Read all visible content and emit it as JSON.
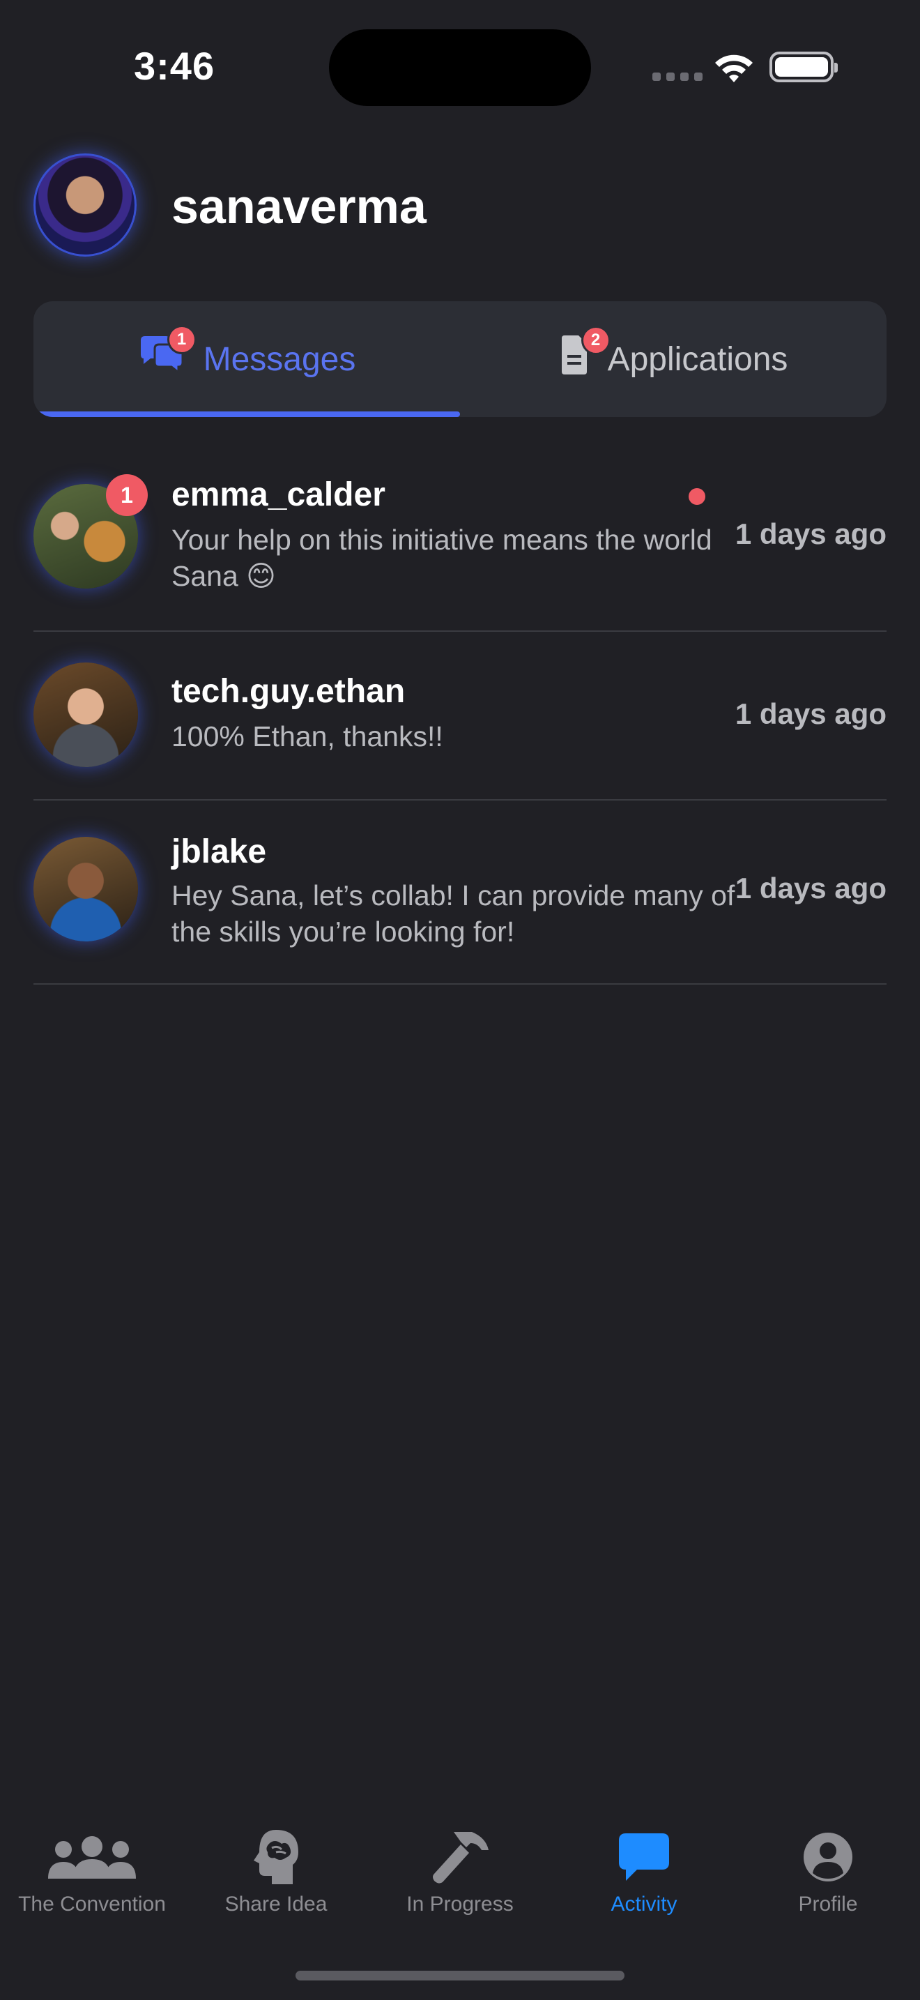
{
  "status_bar": {
    "time": "3:46"
  },
  "header": {
    "username": "sanaverma"
  },
  "tabs": [
    {
      "label": "Messages",
      "badge": "1",
      "icon": "chat-bubbles-icon",
      "active": true
    },
    {
      "label": "Applications",
      "badge": "2",
      "icon": "document-icon",
      "active": false
    }
  ],
  "messages": [
    {
      "sender": "emma_calder",
      "preview": "Your help on this initiative means the world Sana 😊",
      "time": "1 days ago",
      "badge": "1",
      "unread": true
    },
    {
      "sender": "tech.guy.ethan",
      "preview": "100% Ethan, thanks!!",
      "time": "1 days ago",
      "unread": false
    },
    {
      "sender": "jblake",
      "preview": "Hey Sana, let’s collab! I can provide many of the skills you’re looking for!",
      "time": "1 days ago",
      "unread": false
    }
  ],
  "tab_bar": [
    {
      "label": "The Convention",
      "icon": "people-icon",
      "active": false
    },
    {
      "label": "Share Idea",
      "icon": "brain-head-icon",
      "active": false
    },
    {
      "label": "In Progress",
      "icon": "hammer-icon",
      "active": false
    },
    {
      "label": "Activity",
      "icon": "chat-bubble-icon",
      "active": true
    },
    {
      "label": "Profile",
      "icon": "person-circle-icon",
      "active": false
    }
  ],
  "colors": {
    "accent": "#4a68f2",
    "badge": "#f05a64",
    "active_tab": "#1e8cff",
    "background": "#202025"
  }
}
